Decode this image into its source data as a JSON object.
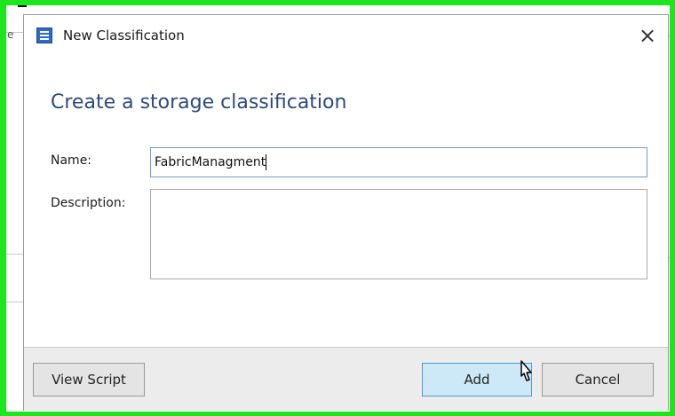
{
  "dialog": {
    "title": "New Classification",
    "close_glyph": "×",
    "heading": "Create a storage classification"
  },
  "form": {
    "name_label": "Name:",
    "name_value": "FabricManagment",
    "description_label": "Description:",
    "description_value": ""
  },
  "footer": {
    "view_script_label": "View Script",
    "add_label": "Add",
    "cancel_label": "Cancel"
  },
  "background": {
    "edge_char": "e"
  },
  "colors": {
    "highlight_frame": "#1ee61e",
    "heading": "#2c4a7c",
    "primary_button": "#cde8f7"
  },
  "icons": {
    "app": "dialog-app-icon",
    "close": "close-icon",
    "cursor": "mouse-pointer-icon"
  }
}
